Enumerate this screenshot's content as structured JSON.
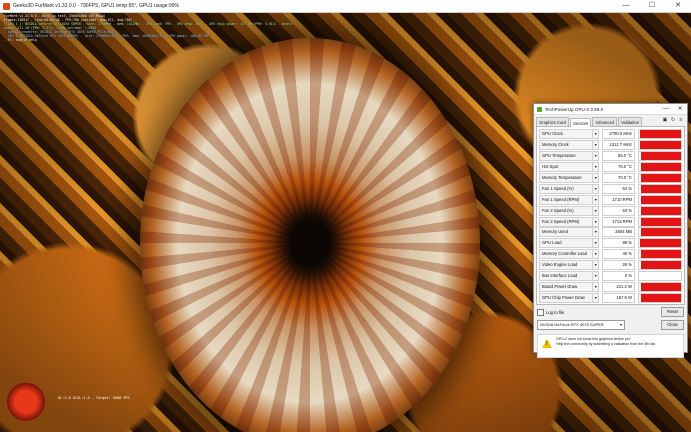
{
  "furmark": {
    "title": "Geeks3D FurMark v1.33.0.0 - 790FPS, GPU1 temp:65°, GPU1 usage:99%",
    "osd_lines": [
      "FurMark v1.33.0.0 - Burn-in test, 2560x1600 (0X MSAA)",
      "Frames:118917 - time:00:03:46 - FPS:790 (min:680, max:872, avg:786)",
      "[ GPU 1 ]: NVIDIA GeForce RTX 4070 SUPER - core: 2790MHz - mem: 1312MHz - GPU load: 99% - GPU temp: 65°C - GPU chip power: 157.6W (PPW: 5.013) - Board power: 221.2W (PPW: 3.571) - GPU voltage: 1.050V",
      "- OpenGL renderer: NVIDIA GeForce RTX 4070 SUPER/PCIe/SSE2",
      "- GPU 1 (NVIDIA GeForce RTX 4070 SUPER) - core: 2790MHz/65° C/99%, mem: 10501MHz/27%, GPU power: 100.0% TDP",
      "- F1: toggle help"
    ],
    "bottom_text": "GL:3.0 GLSL:1.0 - Target: 5000 FPS"
  },
  "gpuz": {
    "title": "TechPowerUp GPU-Z 2.58.0",
    "tabs": [
      "Graphics Card",
      "Sensors",
      "Advanced",
      "Validation"
    ],
    "active_tab": "Sensors",
    "tool_icons": [
      "camera-icon",
      "refresh-icon",
      "menu-icon"
    ],
    "sensors": [
      {
        "label": "GPU Clock",
        "value": "2790.0 MHz",
        "fill": 0.98
      },
      {
        "label": "Memory Clock",
        "value": "1312.7 MHz",
        "fill": 0.98
      },
      {
        "label": "GPU Temperature",
        "value": "65.0 °C",
        "fill": 0.96
      },
      {
        "label": "Hot Spot",
        "value": "75.0 °C",
        "fill": 0.96
      },
      {
        "label": "Memory Temperature",
        "value": "70.0 °C",
        "fill": 0.96
      },
      {
        "label": "Fan 1 Speed (%)",
        "value": "53 %",
        "fill": 0.96
      },
      {
        "label": "Fan 1 Speed (RPM)",
        "value": "1710 RPM",
        "fill": 0.96
      },
      {
        "label": "Fan 2 Speed (%)",
        "value": "53 %",
        "fill": 0.96
      },
      {
        "label": "Fan 2 Speed (RPM)",
        "value": "1713 RPM",
        "fill": 0.96
      },
      {
        "label": "Memory Used",
        "value": "2604 MB",
        "fill": 0.96
      },
      {
        "label": "GPU Load",
        "value": "99 %",
        "fill": 0.98
      },
      {
        "label": "Memory Controller Load",
        "value": "40 %",
        "fill": 0.96
      },
      {
        "label": "Video Engine Load",
        "value": "26 %",
        "fill": 0.96
      },
      {
        "label": "Bus Interface Load",
        "value": "0 %",
        "fill": 0.0
      },
      {
        "label": "Board Power Draw",
        "value": "221.2 W",
        "fill": 0.96
      },
      {
        "label": "GPU Chip Power Draw",
        "value": "157.6 W",
        "fill": 0.96
      }
    ],
    "log_label": "Log to file",
    "reset_label": "Reset",
    "device": "NVIDIA GeForce RTX 4070 SUPER",
    "close_label": "Close",
    "notice_line1": "GPU-Z does not know this graphics device yet.",
    "notice_line2": "Help the community by submitting a validation from the 4th tab.",
    "graph_color": "#e21414"
  }
}
